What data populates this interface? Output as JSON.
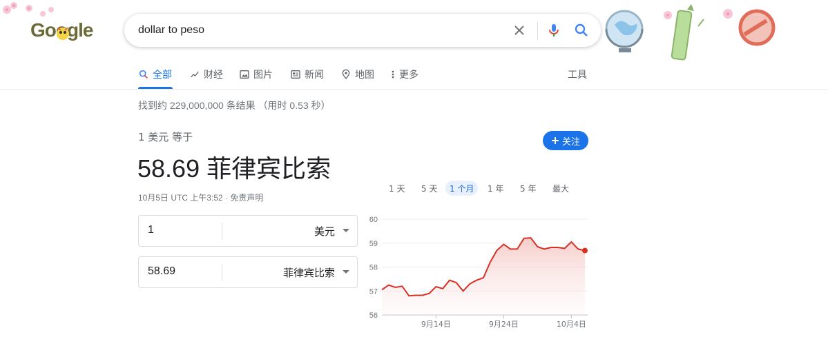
{
  "search": {
    "query": "dollar to peso"
  },
  "logo_text": "Google",
  "tabs": [
    {
      "label": "全部",
      "icon": "search-icon",
      "active": true
    },
    {
      "label": "财经",
      "icon": "finance-icon"
    },
    {
      "label": "图片",
      "icon": "image-icon"
    },
    {
      "label": "新闻",
      "icon": "news-icon"
    },
    {
      "label": "地图",
      "icon": "map-pin-icon"
    },
    {
      "label": "更多",
      "icon": "more-vertical-icon"
    },
    {
      "label": "工具"
    }
  ],
  "result_stats": "找到约 229,000,000 条结果 （用时 0.53 秒）",
  "converter": {
    "from_label": "1 美元 等于",
    "big_value": "58.69 菲律宾比索",
    "timestamp": "10月5日 UTC 上午3:52 · 免责声明",
    "follow_label": "关注",
    "from_amount": "1",
    "from_unit": "美元",
    "to_amount": "58.69",
    "to_unit": "菲律宾比索"
  },
  "ranges": [
    "1 天",
    "5 天",
    "1 个月",
    "1 年",
    "5 年",
    "最大"
  ],
  "active_range": "1 个月",
  "colors": {
    "accent": "#1a73e8",
    "chart_line": "#d93025"
  },
  "chart_data": {
    "type": "area",
    "title": "",
    "xlabel": "",
    "ylabel": "",
    "ylim": [
      56,
      60
    ],
    "yticks": [
      "60",
      "59",
      "58",
      "57",
      "56"
    ],
    "xticks": [
      "9月14日",
      "9月24日",
      "10月4日"
    ],
    "series": [
      {
        "values": [
          57.05,
          57.25,
          57.15,
          57.2,
          56.8,
          56.82,
          56.82,
          56.9,
          57.18,
          57.1,
          57.45,
          57.35,
          57.0,
          57.3,
          57.45,
          57.55,
          58.2,
          58.7,
          58.95,
          58.75,
          58.75,
          59.2,
          59.22,
          58.85,
          58.75,
          58.82,
          58.82,
          58.78,
          59.05,
          58.75,
          58.69
        ]
      }
    ]
  }
}
